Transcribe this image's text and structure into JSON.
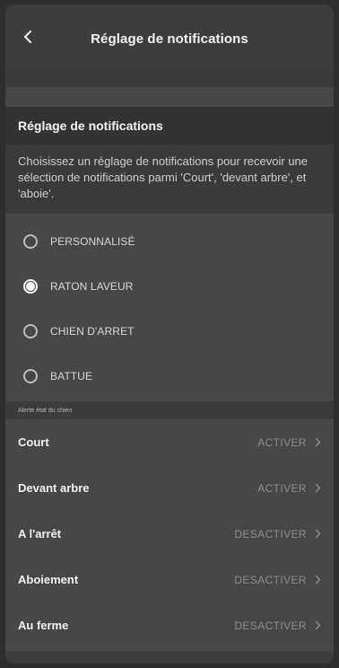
{
  "header": {
    "title": "Réglage de notifications",
    "back_icon": "chevron-left-icon"
  },
  "section": {
    "title": "Réglage de notifications",
    "description": "Choisissez un réglage de notifications pour recevoir une sélection de notifications parmi 'Court', 'devant arbre', et 'aboie'."
  },
  "modes": [
    {
      "label": "PERSONNALISÉ",
      "selected": false
    },
    {
      "label": "RATON LAVEUR",
      "selected": true
    },
    {
      "label": "CHIEN D'ARRET",
      "selected": false
    },
    {
      "label": "BATTUE",
      "selected": false
    }
  ],
  "alerts": {
    "caption": "Alerte état du chien",
    "items": [
      {
        "name": "Court",
        "action": "ACTIVER"
      },
      {
        "name": "Devant arbre",
        "action": "ACTIVER"
      },
      {
        "name": "A l'arrêt",
        "action": "DESACTIVER"
      },
      {
        "name": "Aboiement",
        "action": "DESACTIVER"
      },
      {
        "name": "Au ferme",
        "action": "DESACTIVER"
      }
    ]
  },
  "colors": {
    "background": "#474747",
    "header": "#3d3d3d",
    "muted_text": "#8e8e8e"
  }
}
